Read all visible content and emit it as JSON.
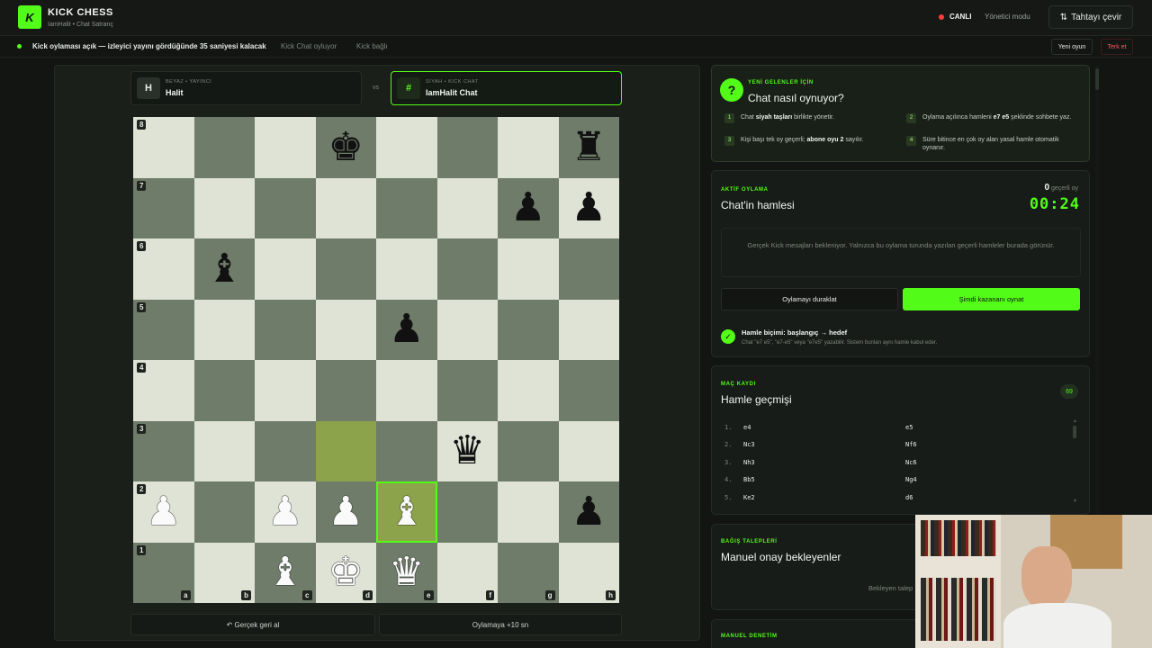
{
  "header": {
    "logo_letter": "K",
    "brand": "KICK CHESS",
    "subtitle": "IamHalit • Chat Satranç",
    "live_label": "CANLI",
    "admin_label": "Yönetici modu",
    "flip_label": "Tahtayı çevir",
    "flip_icon": "⇅"
  },
  "statusbar": {
    "main": "Kick oylaması açık — izleyici yayını gördüğünde 35 saniyesi kalacak",
    "chat_status": "Kick Chat oyluyor",
    "connection": "Kick bağlı",
    "new_game": "Yeni oyun",
    "resign": "Terk et"
  },
  "players": {
    "white": {
      "avatar": "H",
      "role": "BEYAZ • YAYINCI",
      "name": "Halit"
    },
    "vs": "vs",
    "black": {
      "avatar": "#",
      "role": "SİYAH • KICK CHAT",
      "name": "IamHalit Chat"
    }
  },
  "board": {
    "files": [
      "a",
      "b",
      "c",
      "d",
      "e",
      "f",
      "g",
      "h"
    ],
    "ranks": [
      "8",
      "7",
      "6",
      "5",
      "4",
      "3",
      "2",
      "1"
    ],
    "position": [
      [
        "",
        "",
        "",
        "k",
        "",
        "",
        "",
        "r"
      ],
      [
        "",
        "",
        "",
        "",
        "",
        "",
        "p",
        "p"
      ],
      [
        "",
        "b",
        "",
        "",
        "",
        "",
        "",
        ""
      ],
      [
        "",
        "",
        "",
        "",
        "p",
        "",
        "",
        ""
      ],
      [
        "",
        "",
        "",
        "",
        "",
        "",
        "",
        ""
      ],
      [
        "",
        "",
        "",
        "",
        "",
        "q",
        "",
        ""
      ],
      [
        "P",
        "",
        "P",
        "P",
        "B",
        "",
        "",
        "p"
      ],
      [
        "",
        "",
        "B",
        "K",
        "Q",
        "",
        "",
        ""
      ]
    ],
    "last_move_from": "d3",
    "last_move_to": "e2",
    "glyphs": {
      "K": "♚",
      "Q": "♛",
      "R": "♜",
      "B": "♝",
      "N": "♞",
      "P": "♟",
      "k": "♚",
      "q": "♛",
      "r": "♜",
      "b": "♝",
      "n": "♞",
      "p": "♟"
    }
  },
  "controls": {
    "undo": "↶ Gerçek geri al",
    "extend": "Oylamaya +10 sn"
  },
  "howto": {
    "eyebrow": "YENİ GELENLER İÇİN",
    "title": "Chat nasıl oynuyor?",
    "steps": [
      {
        "n": "1",
        "pre": "Chat ",
        "bold": "siyah taşları",
        "post": " birlikte yönetir."
      },
      {
        "n": "2",
        "pre": "Oylama açılınca hamleni ",
        "bold": "e7 e5",
        "post": " şeklinde sohbete yaz."
      },
      {
        "n": "3",
        "pre": "Kişi başı tek oy geçerli; ",
        "bold": "abone oyu 2",
        "post": " sayılır."
      },
      {
        "n": "4",
        "pre": "Süre bitince en çok oy alan yasal hamle otomatik oynanır.",
        "bold": "",
        "post": ""
      }
    ]
  },
  "vote": {
    "eyebrow": "AKTİF OYLAMA",
    "title": "Chat'in hamlesi",
    "valid_count": "0",
    "valid_label": "geçerli oy",
    "timer": "00:24",
    "empty_text": "Gerçek Kick mesajları bekleniyor. Yalnızca bu oylama turunda yazılan geçerli hamleler burada görünür.",
    "pause": "Oylamayı duraklat",
    "play_winner": "Şimdi kazananı oynat",
    "format_title": "Hamle biçimi: başlangıç → hedef",
    "format_sub": "Chat \"e7 e5\", \"e7-e5\" veya \"e7e5\" yazabilir. Sistem bunları aynı hamle kabul eder."
  },
  "history": {
    "eyebrow": "MAÇ KAYDI",
    "title": "Hamle geçmişi",
    "count": "69",
    "moves": [
      {
        "n": "1.",
        "w": "e4",
        "b": "e5"
      },
      {
        "n": "2.",
        "w": "Nc3",
        "b": "Nf6"
      },
      {
        "n": "3.",
        "w": "Nh3",
        "b": "Nc6"
      },
      {
        "n": "4.",
        "w": "Bb5",
        "b": "Ng4"
      },
      {
        "n": "5.",
        "w": "Ke2",
        "b": "d6"
      }
    ]
  },
  "donation": {
    "eyebrow": "BAĞIŞ TALEPLERİ",
    "title": "Manuel onay bekleyenler",
    "empty": "Bekleyen talep"
  },
  "manual": {
    "eyebrow": "MANUEL DENETİM"
  },
  "colors": {
    "accent": "#53fc18",
    "light_square": "#dfe3d6",
    "dark_square": "#6e7c69",
    "highlight": "#8ca34b",
    "live": "#ff3b3b",
    "resign": "#ff5a5a"
  }
}
